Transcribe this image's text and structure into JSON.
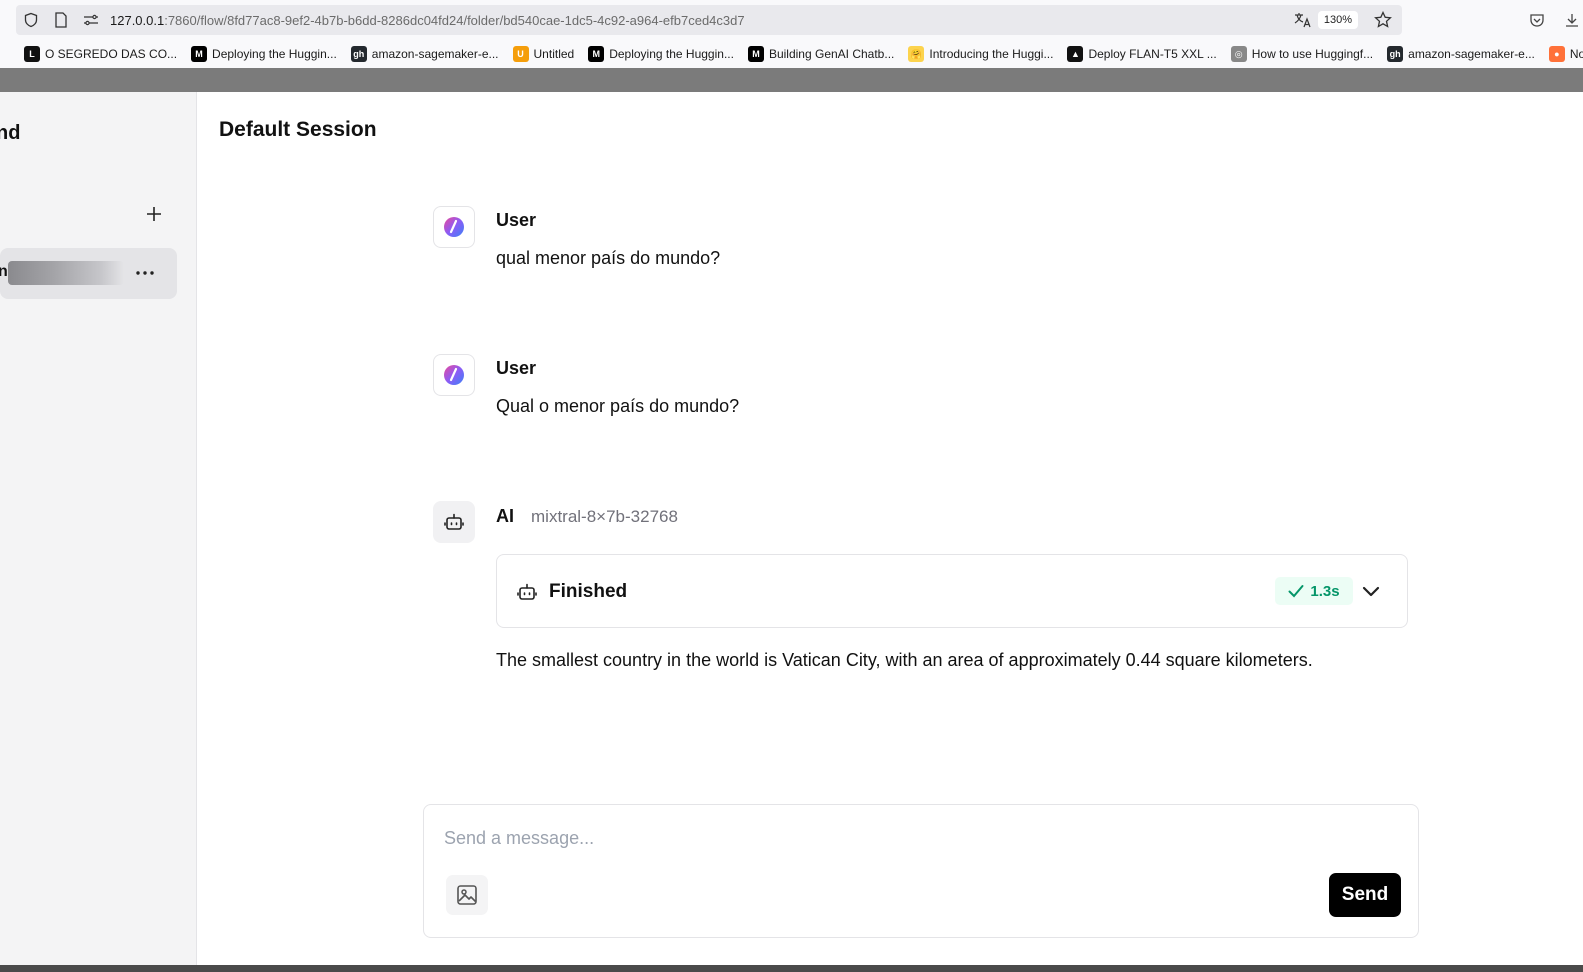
{
  "browser": {
    "url_host": "127.0.0.1",
    "url_rest": ":7860/flow/8fd77ac8-9ef2-4b7b-b6dd-8286dc04fd24/folder/bd540cae-1dc5-4c92-a964-efb7ced4c3d7",
    "zoom": "130%",
    "bookmarks": [
      {
        "label": "O SEGREDO DAS CO...",
        "fav": "L",
        "color": "#111111"
      },
      {
        "label": "Deploying the Huggin...",
        "fav": "M",
        "color": "#000000"
      },
      {
        "label": "amazon-sagemaker-e...",
        "fav": "gh",
        "color": "#24292e"
      },
      {
        "label": "Untitled",
        "fav": "U",
        "color": "#f59e0b"
      },
      {
        "label": "Deploying the Huggin...",
        "fav": "M",
        "color": "#000000"
      },
      {
        "label": "Building GenAI Chatb...",
        "fav": "M",
        "color": "#000000"
      },
      {
        "label": "Introducing the Huggi...",
        "fav": "🤗",
        "color": "#fcd34d"
      },
      {
        "label": "Deploy FLAN-T5 XXL ...",
        "fav": "▲",
        "color": "#111111"
      },
      {
        "label": "How to use Huggingf...",
        "fav": "◎",
        "color": "#888888"
      },
      {
        "label": "amazon-sagemaker-e...",
        "fav": "gh",
        "color": "#24292e"
      },
      {
        "label": "Nova al",
        "fav": "●",
        "color": "#ff7139"
      }
    ]
  },
  "sidebar": {
    "title": "nd",
    "item_label": "n"
  },
  "main": {
    "session_title": "Default Session",
    "messages": [
      {
        "sender": "User",
        "text": "qual menor país do mundo?"
      },
      {
        "sender": "User",
        "text": "Qual o menor país do mundo?"
      },
      {
        "sender": "AI",
        "model": "mixtral-8×7b-32768",
        "status": "Finished",
        "time": "1.3s",
        "text": "The smallest country in the world is Vatican City, with an area of approximately 0.44 square kilometers."
      }
    ],
    "input": {
      "placeholder": "Send a message...",
      "value": "",
      "send_label": "Send"
    }
  },
  "colors": {
    "accent": "#000000",
    "success": "#059669",
    "success_bg": "#ecfdf5"
  }
}
